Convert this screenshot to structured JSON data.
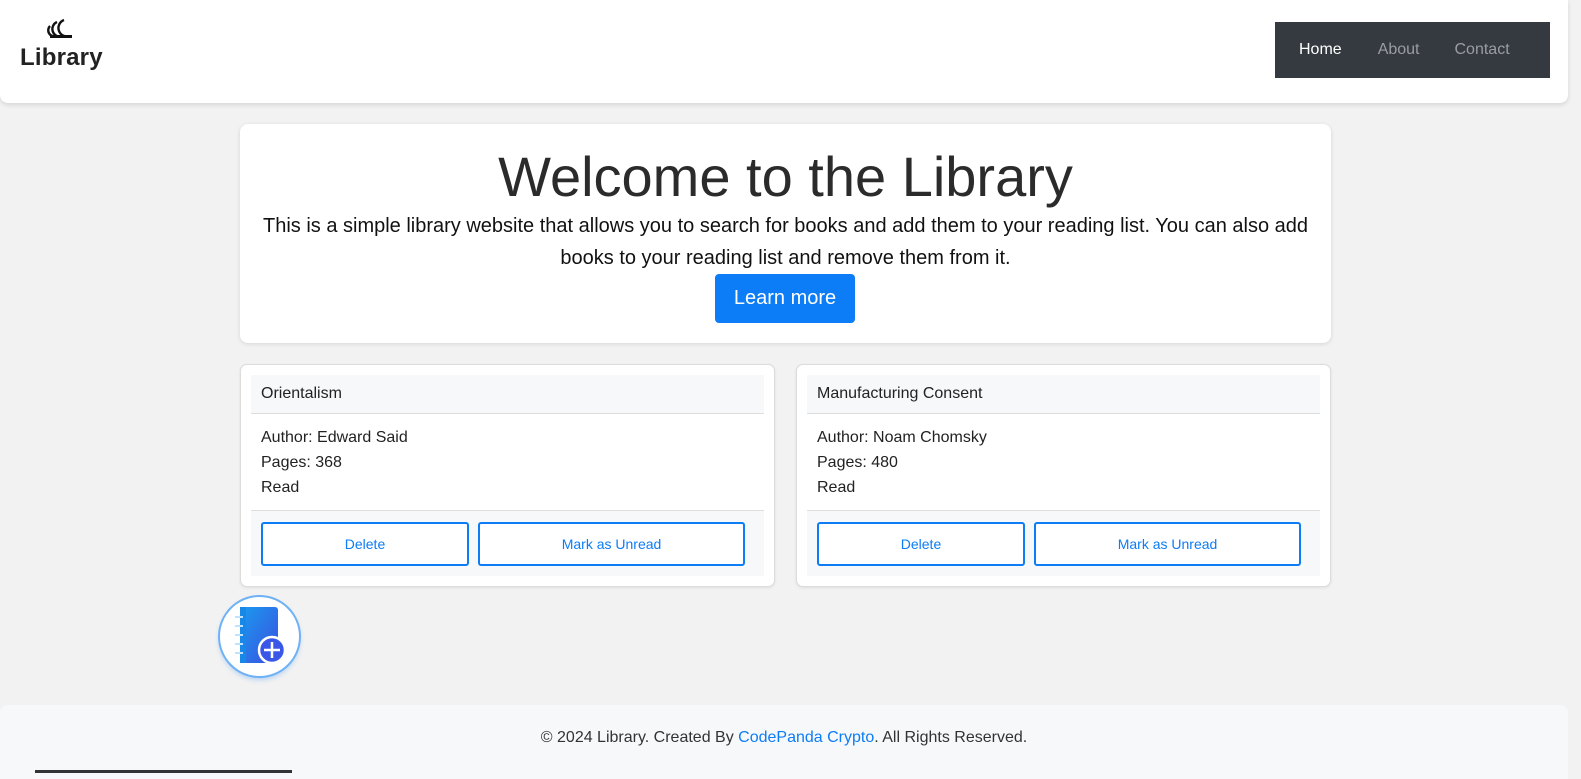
{
  "header": {
    "brand": "Library",
    "nav": {
      "home": "Home",
      "about": "About",
      "contact": "Contact"
    }
  },
  "hero": {
    "title": "Welcome to the Library",
    "text": "This is a simple library website that allows you to search for books and add them to your reading list. You can also add books to your reading list and remove them from it.",
    "button": "Learn more"
  },
  "books": [
    {
      "title": "Orientalism",
      "author": "Author: Edward Said",
      "pages": "Pages: 368",
      "status": "Read",
      "delete": "Delete",
      "toggle": "Mark as Unread"
    },
    {
      "title": "Manufacturing Consent",
      "author": "Author: Noam Chomsky",
      "pages": "Pages: 480",
      "status": "Read",
      "delete": "Delete",
      "toggle": "Mark as Unread"
    }
  ],
  "footer": {
    "prefix": "© 2024 Library. Created By ",
    "link": "CodePanda Crypto",
    "suffix": ". All Rights Reserved."
  },
  "icons": {
    "logo": "library-logo-icon",
    "add_book": "add-book-icon"
  },
  "colors": {
    "primary": "#0d7cf7",
    "nav_bg": "#343a40"
  }
}
